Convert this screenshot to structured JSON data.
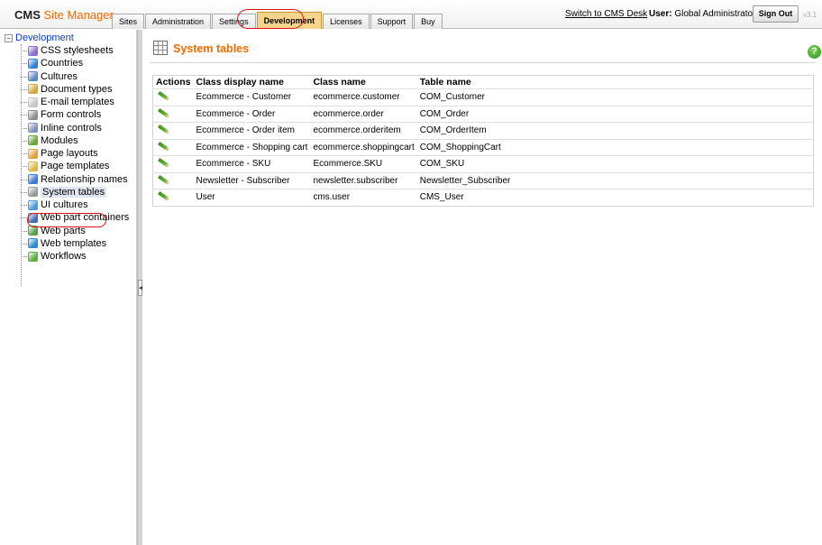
{
  "header": {
    "brand_prefix": "CMS",
    "brand_name": "Site Manager",
    "tabs": [
      {
        "label": "Sites",
        "active": false
      },
      {
        "label": "Administration",
        "active": false
      },
      {
        "label": "Settings",
        "active": false
      },
      {
        "label": "Development",
        "active": true
      },
      {
        "label": "Licenses",
        "active": false
      },
      {
        "label": "Support",
        "active": false
      },
      {
        "label": "Buy",
        "active": false
      }
    ],
    "switch_link": "Switch to CMS Desk",
    "user_label": "User:",
    "user_name": "Global Administrator",
    "sign_out": "Sign Out",
    "version": "v3.1"
  },
  "sidebar": {
    "root_expander": "−",
    "root_label": "Development",
    "items": [
      {
        "label": "CSS stylesheets",
        "icon": "css-stylesheet-icon",
        "color": "#8a6ad0"
      },
      {
        "label": "Countries",
        "icon": "globe-icon",
        "color": "#2f7fd6"
      },
      {
        "label": "Cultures",
        "icon": "culture-globe-icon",
        "color": "#5f88c7"
      },
      {
        "label": "Document types",
        "icon": "document-types-icon",
        "color": "#d6a83b"
      },
      {
        "label": "E-mail templates",
        "icon": "envelope-icon",
        "color": "#c6c6c6"
      },
      {
        "label": "Form controls",
        "icon": "form-control-icon",
        "color": "#8f8f8f"
      },
      {
        "label": "Inline controls",
        "icon": "inline-control-icon",
        "color": "#7f92b8"
      },
      {
        "label": "Modules",
        "icon": "modules-icon",
        "color": "#6da83a"
      },
      {
        "label": "Page layouts",
        "icon": "page-layout-icon",
        "color": "#e3a13b"
      },
      {
        "label": "Page templates",
        "icon": "page-template-icon",
        "color": "#e2b744"
      },
      {
        "label": "Relationship names",
        "icon": "relationship-icon",
        "color": "#3a7bd1"
      },
      {
        "label": "System tables",
        "icon": "system-table-icon",
        "color": "#9a9a9a",
        "selected": true
      },
      {
        "label": "UI cultures",
        "icon": "ui-culture-icon",
        "color": "#4c9ad8"
      },
      {
        "label": "Web part containers",
        "icon": "web-part-container-icon",
        "color": "#3c6fb3"
      },
      {
        "label": "Web parts",
        "icon": "web-parts-icon",
        "color": "#59a14b"
      },
      {
        "label": "Web templates",
        "icon": "web-template-icon",
        "color": "#2b8ad1"
      },
      {
        "label": "Workflows",
        "icon": "workflow-icon",
        "color": "#5cae3d"
      }
    ]
  },
  "main": {
    "title": "System tables",
    "help": "?",
    "columns": [
      "Actions",
      "Class display name",
      "Class name",
      "Table name"
    ],
    "rows": [
      {
        "display": "Ecommerce - Customer",
        "class": "ecommerce.customer",
        "table": "COM_Customer"
      },
      {
        "display": "Ecommerce - Order",
        "class": "ecommerce.order",
        "table": "COM_Order"
      },
      {
        "display": "Ecommerce - Order item",
        "class": "ecommerce.orderitem",
        "table": "COM_OrderItem"
      },
      {
        "display": "Ecommerce - Shopping cart",
        "class": "ecommerce.shoppingcart",
        "table": "COM_ShoppingCart"
      },
      {
        "display": "Ecommerce - SKU",
        "class": "Ecommerce.SKU",
        "table": "COM_SKU"
      },
      {
        "display": "Newsletter - Subscriber",
        "class": "newsletter.subscriber",
        "table": "Newsletter_Subscriber"
      },
      {
        "display": "User",
        "class": "cms.user",
        "table": "CMS_User"
      }
    ]
  },
  "colors": {
    "accent_orange": "#f26b00",
    "active_tab": "#f7d48c",
    "highlight_ring": "#dd1111",
    "tree_link": "#0b3cc5"
  }
}
